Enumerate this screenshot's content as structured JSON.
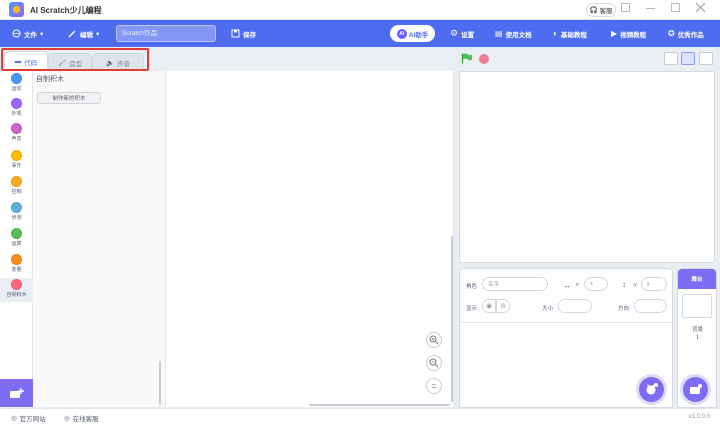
{
  "app": {
    "title": "AI Scratch少儿编程"
  },
  "titlebar": {
    "help_label": "客服"
  },
  "menubar": {
    "file_label": "文件",
    "edit_label": "编辑",
    "project_placeholder": "Scratch作品",
    "save_label": "保存",
    "ai_label": "AI助手",
    "settings_label": "设置",
    "docs_label": "使用文档",
    "basic_tutorial_label": "基础教程",
    "video_tutorial_label": "视频教程",
    "featured_label": "优秀作品"
  },
  "tabs": [
    {
      "label": "代码",
      "active": true
    },
    {
      "label": "造型",
      "active": false
    },
    {
      "label": "声音",
      "active": false
    }
  ],
  "categories": [
    {
      "label": "运动",
      "color": "#4c97ff"
    },
    {
      "label": "外观",
      "color": "#9966ff"
    },
    {
      "label": "声音",
      "color": "#cf63cf"
    },
    {
      "label": "事件",
      "color": "#ffbf00"
    },
    {
      "label": "控制",
      "color": "#ffab19"
    },
    {
      "label": "侦测",
      "color": "#5cb1d6"
    },
    {
      "label": "运算",
      "color": "#59c059"
    },
    {
      "label": "变量",
      "color": "#ff8c1a"
    },
    {
      "label": "自制积木",
      "color": "#ff6680"
    }
  ],
  "palette": {
    "title": "自制积木",
    "make_block_label": "制作新的积木"
  },
  "sprite_info": {
    "sprite_label": "角色",
    "name_placeholder": "名字",
    "x_label": "x",
    "x_placeholder": "x",
    "y_label": "y",
    "y_placeholder": "y",
    "show_label": "显示",
    "size_label": "大小",
    "direction_label": "方向"
  },
  "backdrop": {
    "header_label": "舞台",
    "label": "背景",
    "count": "1"
  },
  "statusbar": {
    "official_site_label": "官方网站",
    "online_support_label": "在线客服",
    "version": "v1.0.0.0"
  },
  "colors": {
    "menubar": "#4d6cf0",
    "accent": "#7e6cf2",
    "highlight": "#e53935"
  }
}
